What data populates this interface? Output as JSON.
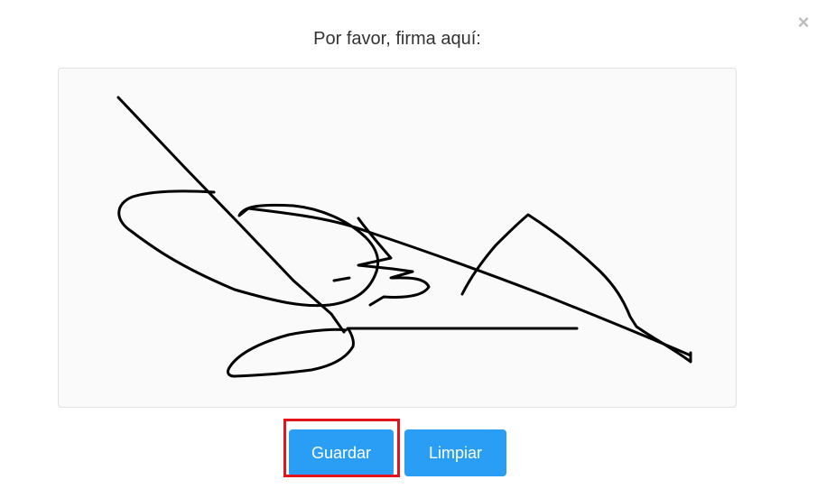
{
  "dialog": {
    "close_glyph": "×",
    "title": "Por favor, firma aquí:"
  },
  "actions": {
    "save_label": "Guardar",
    "clear_label": "Limpiar"
  },
  "colors": {
    "button_bg": "#2a9df4",
    "highlight": "#e3141c",
    "pad_bg": "#fafafa",
    "stroke": "#000000"
  },
  "icons": {
    "close": "close-icon"
  }
}
